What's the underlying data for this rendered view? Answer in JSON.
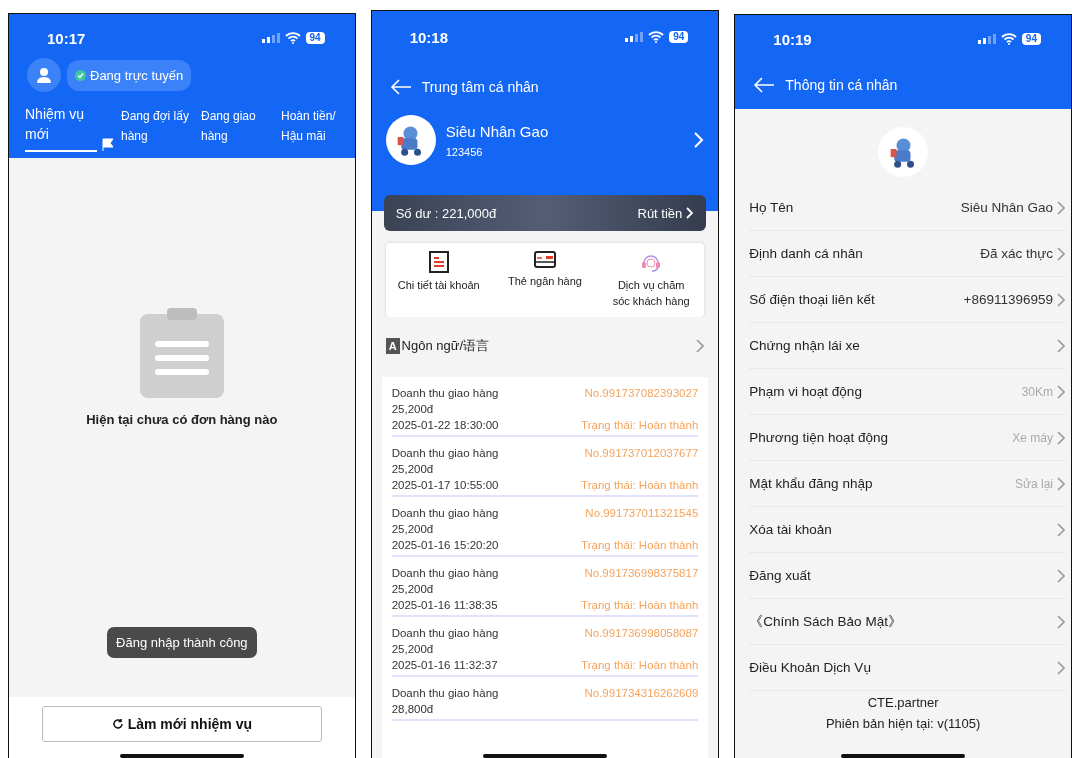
{
  "task_screen": {
    "status_bar": {
      "time": "10:17",
      "battery": "94"
    },
    "online_status": "Đang trực tuyến",
    "tabs": [
      {
        "label": "Nhiệm vụ mới",
        "selected": true
      },
      {
        "label": "Đang đợi lấy hàng",
        "selected": false
      },
      {
        "label": "Đang giao hàng",
        "selected": false
      },
      {
        "label": "Hoàn tiền/ Hậu mãi",
        "selected": false
      }
    ],
    "empty_message": "Hiện tại chưa có đơn hàng nào",
    "toast": "Đăng nhập thành công",
    "refresh_button": "Làm mới nhiệm vụ"
  },
  "profile_screen": {
    "status_bar": {
      "time": "10:18",
      "battery": "94"
    },
    "title": "Trung tâm cá nhân",
    "user": {
      "name": "Siêu Nhân Gao",
      "id": "123456"
    },
    "balance": {
      "label": "Số dư : 221,000đ",
      "action": "Rút tiền"
    },
    "shortcuts": [
      {
        "label": "Chi tiết tài khoản",
        "kind": "ledger"
      },
      {
        "label": "Thẻ ngân hàng",
        "kind": "card"
      },
      {
        "label": "Dịch vụ chăm sóc khách hàng",
        "kind": "headset"
      }
    ],
    "language": {
      "icon": "A",
      "label": "Ngôn ngữ/语言"
    },
    "transactions": [
      {
        "title": "Doanh thu giao hàng",
        "amount": "25,200đ",
        "time": "2025-01-22 18:30:00",
        "number": "No.991737082393027",
        "status": "Trạng thái: Hoàn thành"
      },
      {
        "title": "Doanh thu giao hàng",
        "amount": "25,200đ",
        "time": "2025-01-17 10:55:00",
        "number": "No.991737012037677",
        "status": "Trạng thái: Hoàn thành"
      },
      {
        "title": "Doanh thu giao hàng",
        "amount": "25,200đ",
        "time": "2025-01-16 15:20:20",
        "number": "No.991737011321545",
        "status": "Trạng thái: Hoàn thành"
      },
      {
        "title": "Doanh thu giao hàng",
        "amount": "25,200đ",
        "time": "2025-01-16 11:38:35",
        "number": "No.991736998375817",
        "status": "Trạng thái: Hoàn thành"
      },
      {
        "title": "Doanh thu giao hàng",
        "amount": "25,200đ",
        "time": "2025-01-16 11:32:37",
        "number": "No.991736998058087",
        "status": "Trạng thái: Hoàn thành"
      },
      {
        "title": "Doanh thu giao hàng",
        "amount": "28,800đ",
        "number": "No.991734316262609"
      }
    ]
  },
  "info_screen": {
    "status_bar": {
      "time": "10:19",
      "battery": "94"
    },
    "title": "Thông tin cá nhân",
    "rows": [
      {
        "label": "Họ Tên",
        "value": "Siêu Nhân Gao",
        "muted": false
      },
      {
        "label": "Định danh cá nhân",
        "value": "Đã xác thực",
        "muted": false
      },
      {
        "label": "Số điện thoại liên kết",
        "value": "+86911396959",
        "muted": false
      },
      {
        "label": "Chứng nhận lái xe"
      },
      {
        "label": "Phạm vi hoạt động",
        "value": "30Km",
        "muted": true
      },
      {
        "label": "Phương tiện hoạt động",
        "value": "Xe máy",
        "muted": true
      },
      {
        "label": "Mật khẩu đăng nhập",
        "value": "Sửa lại",
        "muted": true
      },
      {
        "label": "Xóa tài khoản"
      },
      {
        "label": "Đăng xuất"
      },
      {
        "label": "《Chính Sách Bảo Mật》"
      },
      {
        "label": "Điều Khoản Dịch Vụ"
      }
    ],
    "footer": {
      "app_name": "CTE.partner",
      "version": "Phiên bản hiện tại: v(1105)"
    }
  }
}
